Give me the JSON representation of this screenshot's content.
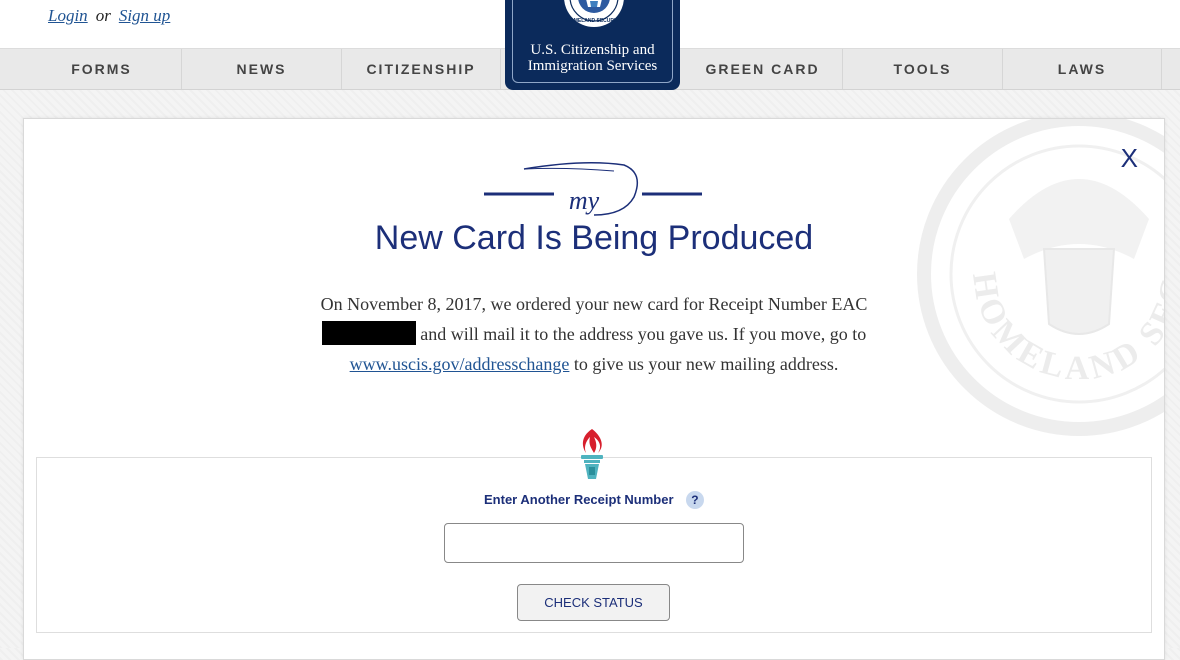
{
  "header": {
    "login_label": "Login",
    "or_text": "or",
    "signup_label": "Sign up"
  },
  "logo": {
    "line1": "U.S. Citizenship and",
    "line2": "Immigration Services",
    "seal_text": "HOMELAND SECURITY"
  },
  "nav": {
    "items": [
      {
        "label": "FORMS"
      },
      {
        "label": "NEWS"
      },
      {
        "label": "CITIZENSHIP"
      },
      {
        "label": "GREEN CARD"
      },
      {
        "label": "TOOLS"
      },
      {
        "label": "LAWS"
      }
    ]
  },
  "modal": {
    "close_label": "X",
    "brand_word": "my",
    "title": "New Card Is Being Produced",
    "message_part1": "On November 8, 2017, we ordered your new card for Receipt Number EAC",
    "message_part2": " and will mail it to the address you gave us. If you move, go to ",
    "link_text": "www.uscis.gov/addresschange",
    "message_part3": " to give us your new mailing address.",
    "watermark_text": "HOMELAND SECU"
  },
  "form": {
    "label": "Enter Another Receipt Number",
    "help_label": "?",
    "input_value": "",
    "button_label": "CHECK STATUS"
  },
  "colors": {
    "navy": "#1c2f79",
    "logo_bg": "#0b2a5b",
    "link": "#205493",
    "torch_flame": "#d71f2d",
    "torch_base": "#4fb3bf"
  }
}
